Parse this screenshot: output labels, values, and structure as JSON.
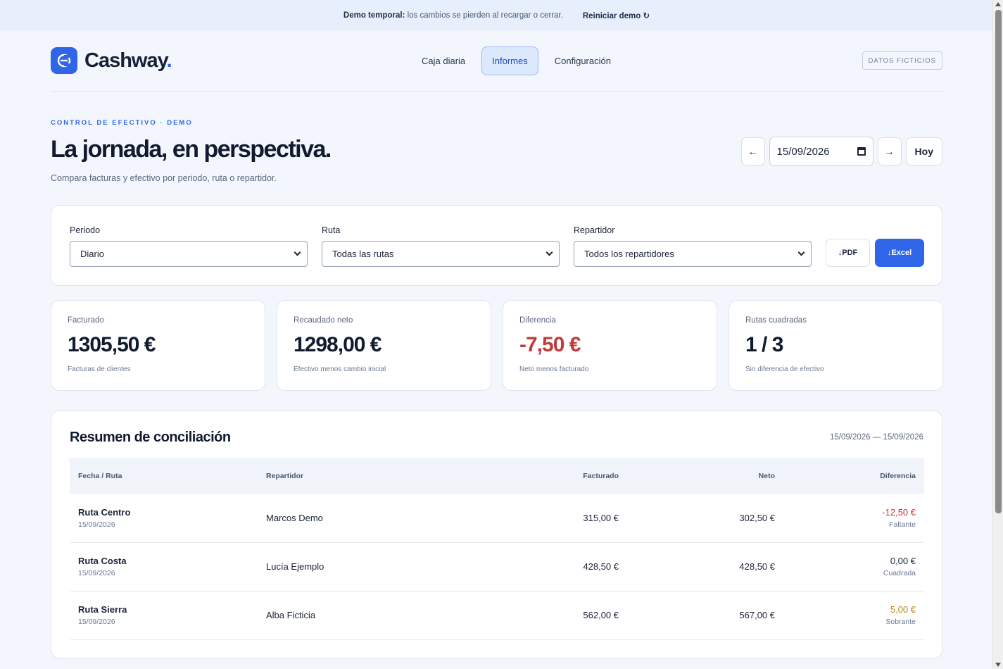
{
  "banner": {
    "strong": "Demo temporal:",
    "text": "los cambios se pierden al recargar o cerrar.",
    "reset": "Reiniciar demo ↻"
  },
  "brand": {
    "name": "Cashway",
    "dot": ".",
    "accent": "#2f66e8"
  },
  "nav": {
    "items": [
      "Caja diaria",
      "Informes",
      "Configuración"
    ],
    "active": "Informes"
  },
  "badge": "DATOS FICTICIOS",
  "hero": {
    "eyebrow": "CONTROL DE EFECTIVO · DEMO",
    "title": "La jornada, en perspectiva.",
    "subtitle": "Compara facturas y efectivo por periodo, ruta o repartidor."
  },
  "date_nav": {
    "prev": "←",
    "date": "15/09/2026",
    "next": "→",
    "today": "Hoy"
  },
  "filters": {
    "period": {
      "label": "Periodo",
      "value": "Diario"
    },
    "route": {
      "label": "Ruta",
      "value": "Todas las rutas"
    },
    "driver": {
      "label": "Repartidor",
      "value": "Todos los repartidores"
    },
    "pdf": "↓PDF",
    "excel": "↓Excel"
  },
  "kpis": [
    {
      "label": "Facturado",
      "value": "1305,50 €",
      "foot": "Facturas de clientes"
    },
    {
      "label": "Recaudado neto",
      "value": "1298,00 €",
      "foot": "Efectivo menos cambio inicial"
    },
    {
      "label": "Diferencia",
      "value": "-7,50 €",
      "foot": "Neto menos facturado"
    },
    {
      "label": "Rutas cuadradas",
      "value": "1 / 3",
      "foot": "Sin diferencia de efectivo"
    }
  ],
  "summary": {
    "title": "Resumen de conciliación",
    "range": "15/09/2026 — 15/09/2026",
    "headers": [
      "Fecha / Ruta",
      "Repartidor",
      "Facturado",
      "Neto",
      "Diferencia"
    ],
    "rows": [
      {
        "route": "Ruta Centro",
        "date": "15/09/2026",
        "driver": "Marcos Demo",
        "billed": "315,00 €",
        "net": "302,50 €",
        "diff": "-12,50 €",
        "status": "Faltante"
      },
      {
        "route": "Ruta Costa",
        "date": "15/09/2026",
        "driver": "Lucía Ejemplo",
        "billed": "428,50 €",
        "net": "428,50 €",
        "diff": "0,00 €",
        "status": "Cuadrada"
      },
      {
        "route": "Ruta Sierra",
        "date": "15/09/2026",
        "driver": "Alba Ficticia",
        "billed": "562,00 €",
        "net": "567,00 €",
        "diff": "5,00 €",
        "status": "Sobrante"
      }
    ]
  },
  "colors": {
    "negative": "#c23b3b",
    "surplus": "#b88510",
    "primary": "#2f66e8"
  }
}
